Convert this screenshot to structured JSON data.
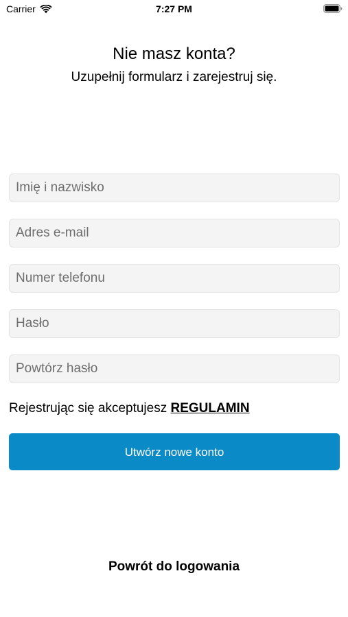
{
  "status_bar": {
    "carrier": "Carrier",
    "time": "7:27 PM",
    "icons": [
      "wifi-icon",
      "battery-icon"
    ]
  },
  "header": {
    "title": "Nie masz konta?",
    "subtitle": "Uzupełnij formularz i zarejestruj się."
  },
  "form": {
    "fields": [
      {
        "placeholder": "Imię i nazwisko",
        "value": ""
      },
      {
        "placeholder": "Adres e-mail",
        "value": ""
      },
      {
        "placeholder": "Numer telefonu",
        "value": ""
      },
      {
        "placeholder": "Hasło",
        "value": ""
      },
      {
        "placeholder": "Powtórz hasło",
        "value": ""
      }
    ],
    "terms_text": "Rejestrując się akceptujesz ",
    "terms_link": "REGULAMIN",
    "submit_label": "Utwórz nowe konto"
  },
  "footer": {
    "back_label": "Powrót do logowania"
  },
  "colors": {
    "accent": "#0a8bc7",
    "field_background": "#f4f4f4",
    "field_border": "#e3e3e3",
    "placeholder": "#6e6e6e",
    "text": "#000000"
  }
}
